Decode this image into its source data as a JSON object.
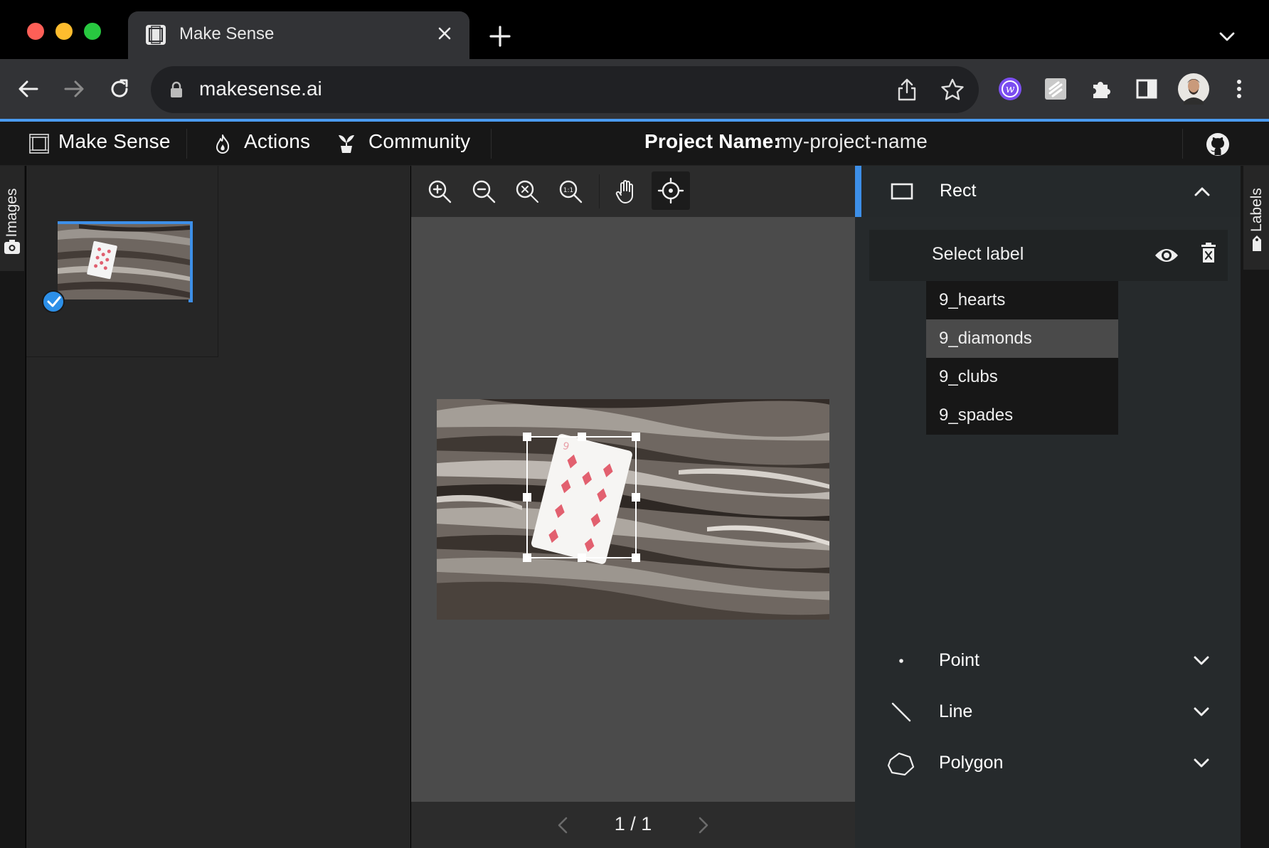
{
  "browser": {
    "tab_title": "Make Sense",
    "url": "makesense.ai"
  },
  "app": {
    "brand": "Make Sense",
    "menu": [
      "Actions",
      "Community"
    ],
    "project_label": "Project Name:",
    "project_name": "my-project-name"
  },
  "left_sidebar": {
    "tab_label": "Images"
  },
  "editor": {
    "page_indicator": "1 / 1"
  },
  "right_panel": {
    "tab_label": "Labels",
    "tools": [
      {
        "name": "Rect",
        "icon": "rectangle-icon",
        "expanded": true
      },
      {
        "name": "Point",
        "icon": "point-icon",
        "expanded": false
      },
      {
        "name": "Line",
        "icon": "line-icon",
        "expanded": false
      },
      {
        "name": "Polygon",
        "icon": "polygon-icon",
        "expanded": false
      }
    ],
    "select_label_placeholder": "Select label",
    "label_options": [
      "9_hearts",
      "9_diamonds",
      "9_clubs",
      "9_spades"
    ],
    "highlighted_option": "9_diamonds"
  },
  "colors": {
    "accent": "#3d8fe8",
    "canvas_bg": "#4b4b4b",
    "panel_bg": "#262626"
  }
}
